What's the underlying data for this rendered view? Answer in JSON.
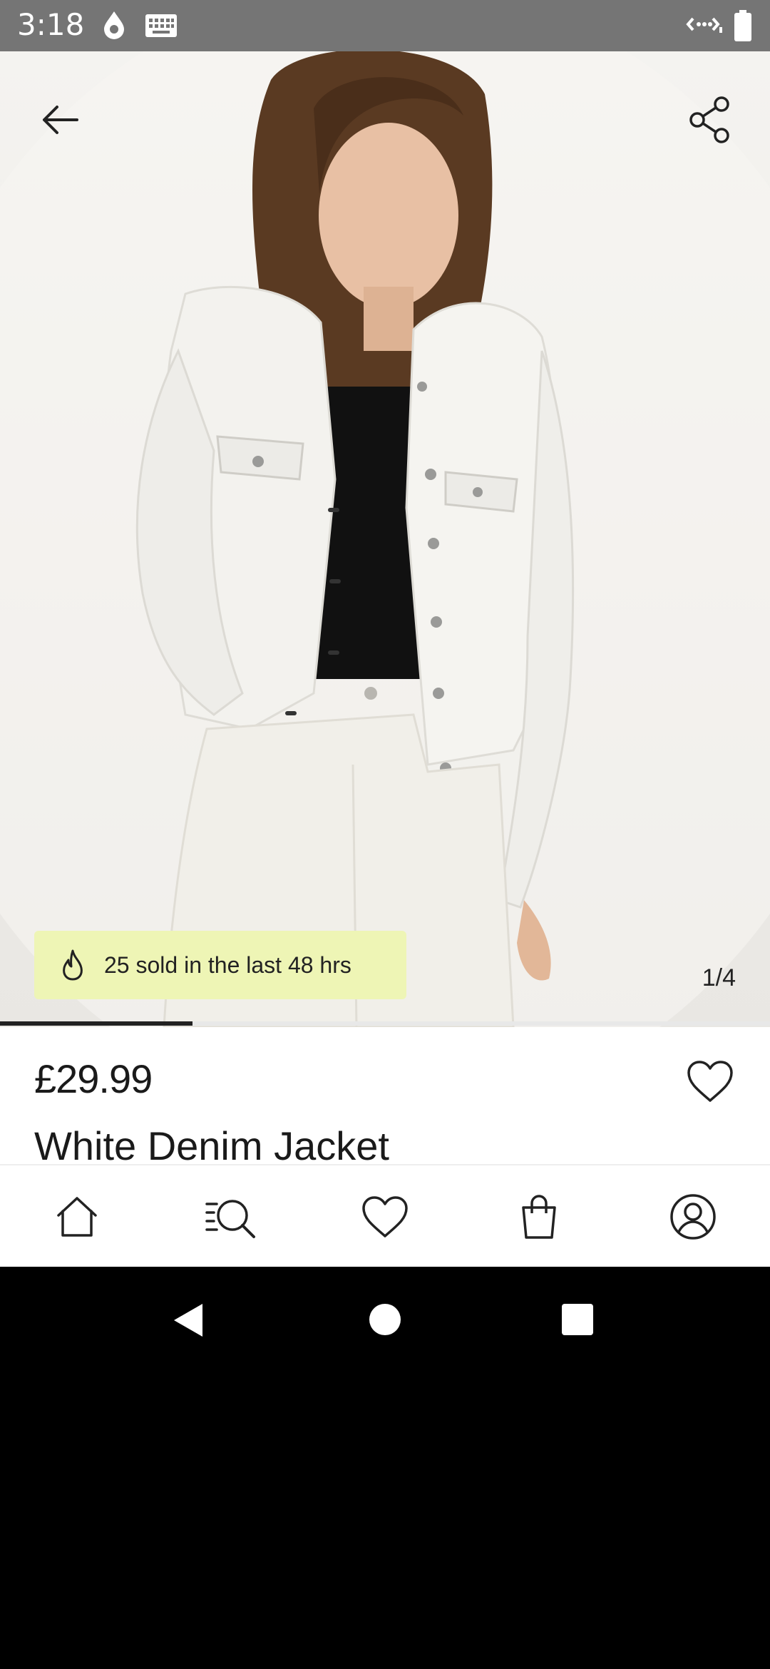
{
  "status_bar": {
    "time": "3:18",
    "icons": [
      "drop-icon",
      "keyboard-icon",
      "data-transfer-icon",
      "battery-icon"
    ]
  },
  "product": {
    "image_counter": "1/4",
    "image_progress": 0.25,
    "sold_badge": "25 sold in the last 48 hrs",
    "price": "£29.99",
    "name": "White Denim Jacket"
  },
  "top_bar": {
    "back_icon": "arrow-left-icon",
    "share_icon": "share-icon"
  },
  "bottom_nav": {
    "items": [
      "home-icon",
      "search-icon",
      "heart-icon",
      "bag-icon",
      "profile-icon"
    ]
  },
  "colors": {
    "badge_bg": "#eef5b5",
    "text": "#1a1a1a",
    "status_bar_bg": "#757575"
  }
}
